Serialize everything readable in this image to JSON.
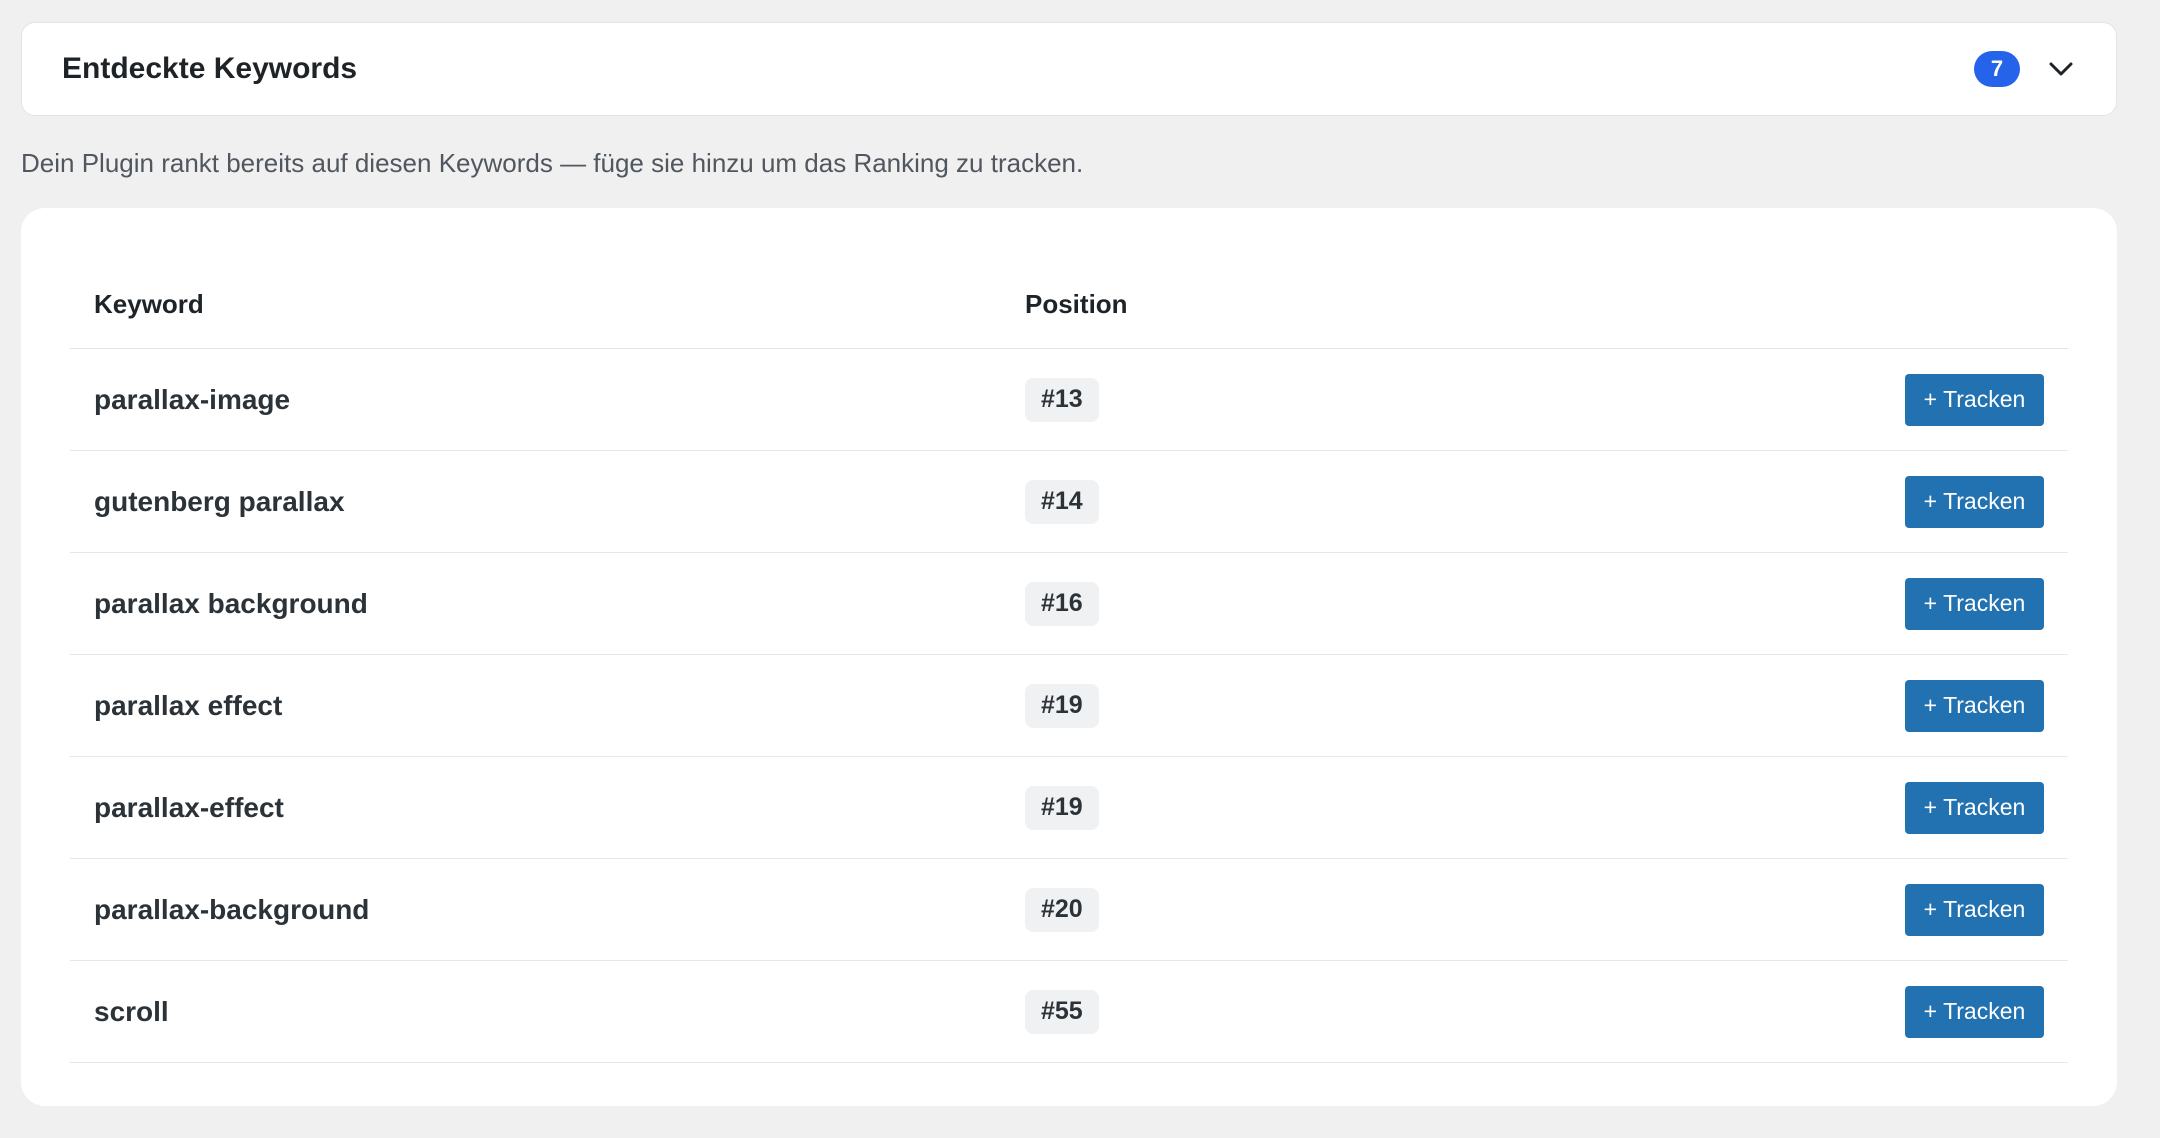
{
  "header": {
    "title": "Entdeckte Keywords",
    "count": "7"
  },
  "description": "Dein Plugin rankt bereits auf diesen Keywords — füge sie hinzu um das Ranking zu tracken.",
  "table": {
    "columns": [
      "Keyword",
      "Position"
    ],
    "rows": [
      {
        "keyword": "parallax-image",
        "position": "#13",
        "action": "+ Tracken"
      },
      {
        "keyword": "gutenberg parallax",
        "position": "#14",
        "action": "+ Tracken"
      },
      {
        "keyword": "parallax background",
        "position": "#16",
        "action": "+ Tracken"
      },
      {
        "keyword": "parallax effect",
        "position": "#19",
        "action": "+ Tracken"
      },
      {
        "keyword": "parallax-effect",
        "position": "#19",
        "action": "+ Tracken"
      },
      {
        "keyword": "parallax-background",
        "position": "#20",
        "action": "+ Tracken"
      },
      {
        "keyword": "scroll",
        "position": "#55",
        "action": "+ Tracken"
      }
    ]
  },
  "colors": {
    "badge": "#2563eb",
    "button": "#2271b1",
    "background": "#f0f0f1"
  },
  "icons": {
    "collapse": "chevron-down-icon"
  }
}
